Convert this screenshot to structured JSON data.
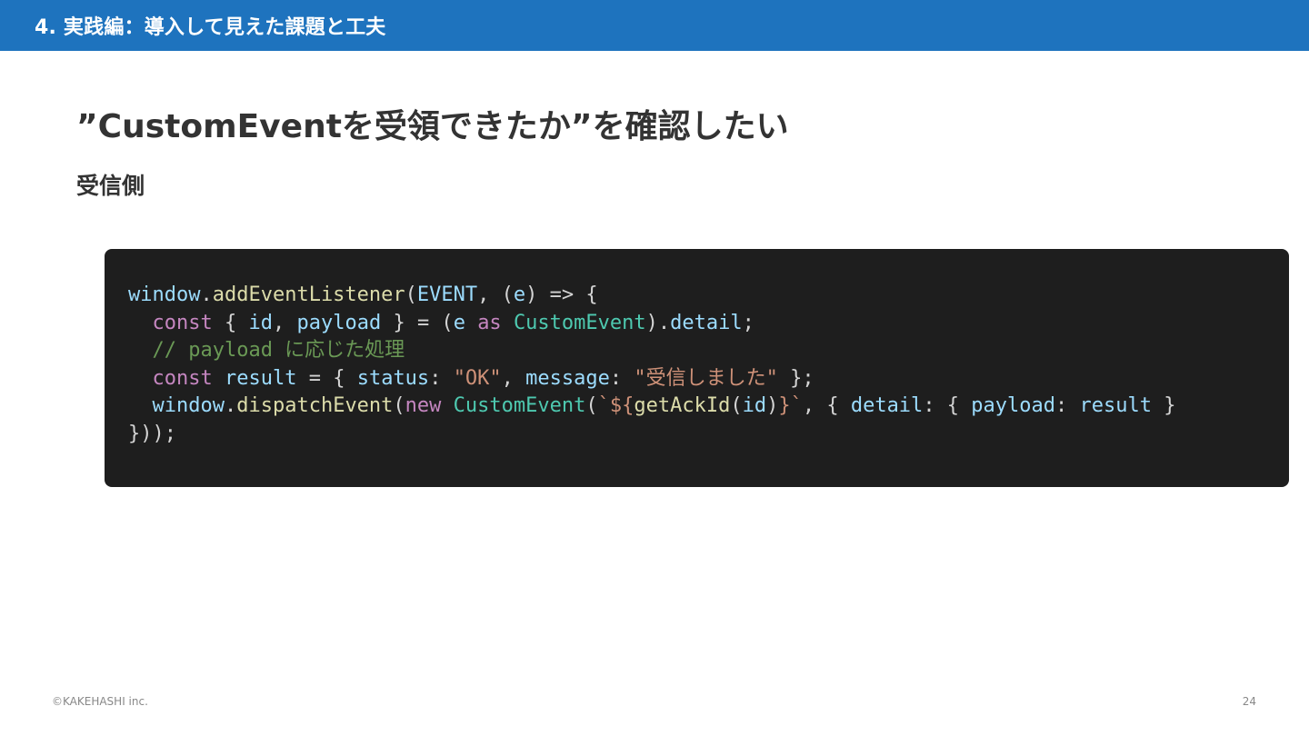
{
  "header": {
    "title": "4. 実践編：導入して見えた課題と工夫",
    "background_color": "#1e73be"
  },
  "slide": {
    "title": "”CustomEventを受領できたか”を確認したい",
    "subtitle": "受信側"
  },
  "code": {
    "lines": [
      [
        {
          "t": "window",
          "c": "tk-ident"
        },
        {
          "t": ".",
          "c": "tk-plain"
        },
        {
          "t": "addEventListener",
          "c": "tk-func"
        },
        {
          "t": "(",
          "c": "tk-plain"
        },
        {
          "t": "EVENT",
          "c": "tk-ident"
        },
        {
          "t": ", (",
          "c": "tk-plain"
        },
        {
          "t": "e",
          "c": "tk-ident"
        },
        {
          "t": ") => {",
          "c": "tk-plain"
        }
      ],
      [
        {
          "t": "  ",
          "c": "tk-plain"
        },
        {
          "t": "const",
          "c": "tk-key"
        },
        {
          "t": " { ",
          "c": "tk-plain"
        },
        {
          "t": "id",
          "c": "tk-ident"
        },
        {
          "t": ", ",
          "c": "tk-plain"
        },
        {
          "t": "payload",
          "c": "tk-ident"
        },
        {
          "t": " } = (",
          "c": "tk-plain"
        },
        {
          "t": "e",
          "c": "tk-ident"
        },
        {
          "t": " ",
          "c": "tk-plain"
        },
        {
          "t": "as",
          "c": "tk-key"
        },
        {
          "t": " ",
          "c": "tk-plain"
        },
        {
          "t": "CustomEvent",
          "c": "tk-cls"
        },
        {
          "t": ").",
          "c": "tk-plain"
        },
        {
          "t": "detail",
          "c": "tk-ident"
        },
        {
          "t": ";",
          "c": "tk-plain"
        }
      ],
      [
        {
          "t": "  // payload に応じた処理",
          "c": "tk-comment"
        }
      ],
      [
        {
          "t": "  ",
          "c": "tk-plain"
        },
        {
          "t": "const",
          "c": "tk-key"
        },
        {
          "t": " ",
          "c": "tk-plain"
        },
        {
          "t": "result",
          "c": "tk-ident"
        },
        {
          "t": " = { ",
          "c": "tk-plain"
        },
        {
          "t": "status",
          "c": "tk-ident"
        },
        {
          "t": ": ",
          "c": "tk-plain"
        },
        {
          "t": "\"OK\"",
          "c": "tk-str"
        },
        {
          "t": ", ",
          "c": "tk-plain"
        },
        {
          "t": "message",
          "c": "tk-ident"
        },
        {
          "t": ": ",
          "c": "tk-plain"
        },
        {
          "t": "\"受信しました\"",
          "c": "tk-str"
        },
        {
          "t": " };",
          "c": "tk-plain"
        }
      ],
      [
        {
          "t": "  ",
          "c": "tk-plain"
        },
        {
          "t": "window",
          "c": "tk-ident"
        },
        {
          "t": ".",
          "c": "tk-plain"
        },
        {
          "t": "dispatchEvent",
          "c": "tk-func"
        },
        {
          "t": "(",
          "c": "tk-plain"
        },
        {
          "t": "new",
          "c": "tk-key"
        },
        {
          "t": " ",
          "c": "tk-plain"
        },
        {
          "t": "CustomEvent",
          "c": "tk-cls"
        },
        {
          "t": "(",
          "c": "tk-plain"
        },
        {
          "t": "`${",
          "c": "tk-tpl"
        },
        {
          "t": "getAckId",
          "c": "tk-func"
        },
        {
          "t": "(",
          "c": "tk-plain"
        },
        {
          "t": "id",
          "c": "tk-ident"
        },
        {
          "t": ")",
          "c": "tk-plain"
        },
        {
          "t": "}`",
          "c": "tk-tpl"
        },
        {
          "t": ", { ",
          "c": "tk-plain"
        },
        {
          "t": "detail",
          "c": "tk-ident"
        },
        {
          "t": ": { ",
          "c": "tk-plain"
        },
        {
          "t": "payload",
          "c": "tk-ident"
        },
        {
          "t": ": ",
          "c": "tk-plain"
        },
        {
          "t": "result",
          "c": "tk-ident"
        },
        {
          "t": " } ",
          "c": "tk-plain"
        }
      ],
      [
        {
          "t": "}));",
          "c": "tk-plain"
        }
      ]
    ]
  },
  "footer": {
    "copyright": "©KAKEHASHI inc.",
    "page_number": "24"
  }
}
